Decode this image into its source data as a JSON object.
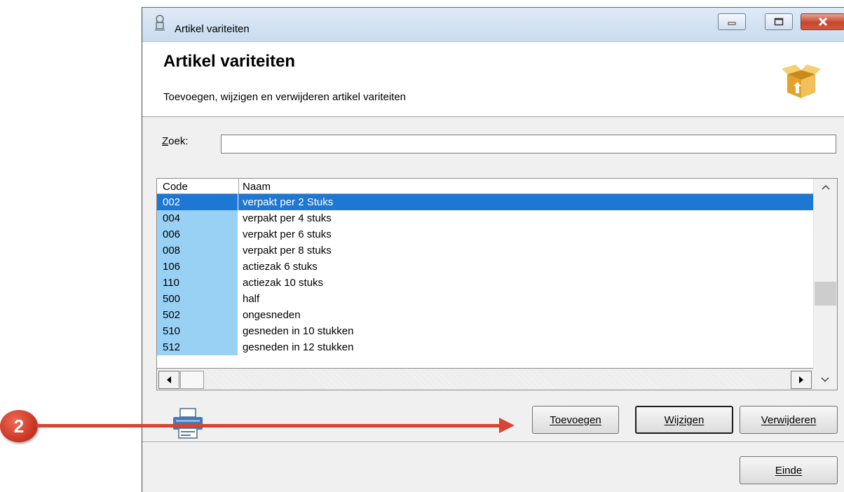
{
  "window": {
    "title": "Artikel variteiten",
    "controls": {
      "minimize": "minimize-icon",
      "maximize": "maximize-icon",
      "close": "close-icon"
    }
  },
  "header": {
    "title": "Artikel variteiten",
    "subtitle": "Toevoegen, wijzigen en verwijderen artikel variteiten",
    "icon": "box-icon"
  },
  "search": {
    "label": "Zoek:",
    "value": ""
  },
  "table": {
    "columns": [
      "Code",
      "Naam"
    ],
    "rows": [
      {
        "code": "002",
        "naam": "verpakt per 2 Stuks",
        "selected": true
      },
      {
        "code": "004",
        "naam": "verpakt per 4 stuks"
      },
      {
        "code": "006",
        "naam": "verpakt per 6 stuks"
      },
      {
        "code": "008",
        "naam": "verpakt per 8 stuks"
      },
      {
        "code": "106",
        "naam": "actiezak 6 stuks"
      },
      {
        "code": "110",
        "naam": "actiezak 10 stuks"
      },
      {
        "code": "500",
        "naam": "half"
      },
      {
        "code": "502",
        "naam": "ongesneden"
      },
      {
        "code": "510",
        "naam": "gesneden in 10 stukken"
      },
      {
        "code": "512",
        "naam": "gesneden in 12 stukken"
      }
    ]
  },
  "buttons": {
    "toevoegen": "Toevoegen",
    "wijzigen": "Wijzigen",
    "verwijderen": "Verwijderen",
    "einde": "Einde"
  },
  "annotation": {
    "badge": "2"
  },
  "colors": {
    "selection": "#1e77d3",
    "code_column": "#99d1f5",
    "annotation": "#d64533"
  }
}
